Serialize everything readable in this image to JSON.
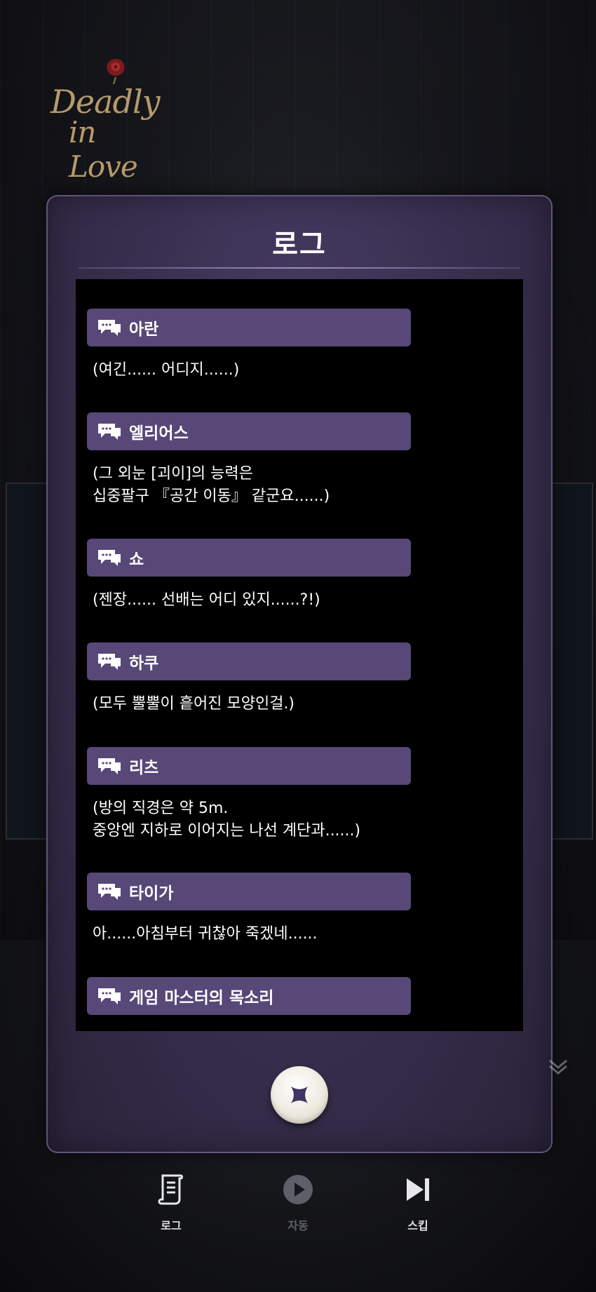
{
  "logo": {
    "line1": "Deadly",
    "line2": "in Love"
  },
  "panel": {
    "title": "로그",
    "close_icon": "close-x-icon"
  },
  "log_entries": [
    {
      "speaker": "아란",
      "text": "(여긴...... 어디지......)"
    },
    {
      "speaker": "엘리어스",
      "text": "(그 외눈 [괴이]의 능력은\n십중팔구 『공간 이동』 같군요......)"
    },
    {
      "speaker": "쇼",
      "text": "(젠장...... 선배는 어디 있지......?!)"
    },
    {
      "speaker": "하쿠",
      "text": "(모두 뿔뿔이 흩어진 모양인걸.)"
    },
    {
      "speaker": "리츠",
      "text": "(방의 직경은 약 5m.\n중앙엔 지하로 이어지는 나선 계단과......)"
    },
    {
      "speaker": "타이가",
      "text": "아......아침부터 귀찮아 죽겠네......"
    },
    {
      "speaker": "게임 마스터의 목소리",
      "text": ""
    }
  ],
  "bottom_bar": {
    "log_label": "로그",
    "auto_label": "자동",
    "skip_label": "스킵"
  },
  "colors": {
    "panel": "#3a3152",
    "name_bar": "#574878",
    "log_bg": "#000000",
    "logo_gold": "#b79a6b"
  }
}
